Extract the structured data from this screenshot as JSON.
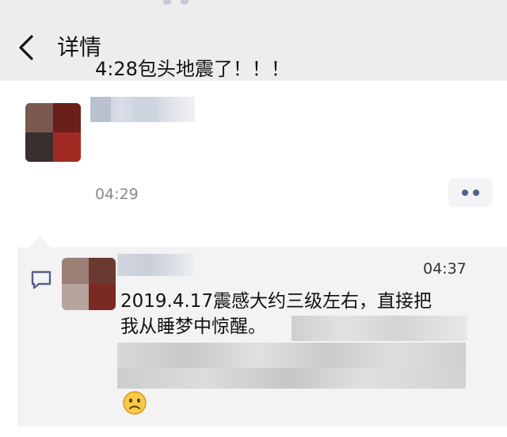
{
  "header": {
    "title": "详情"
  },
  "post": {
    "text": "4:28包头地震了！！！",
    "time": "04:29"
  },
  "comment": {
    "time": "04:37",
    "text_line1": "2019.4.17震感大约三级左右，直接把",
    "text_line2": "我从睡梦中惊醒。"
  },
  "icons": {
    "back": "chevron-left-icon",
    "more": "more-dots-icon",
    "comment": "comment-icon",
    "emoji": "sad-face-emoji"
  },
  "colors": {
    "background": "#ededed",
    "card": "#ffffff",
    "comment_bg": "#f3f3f3",
    "accent": "#56608a",
    "muted_text": "#8a8a8a"
  }
}
